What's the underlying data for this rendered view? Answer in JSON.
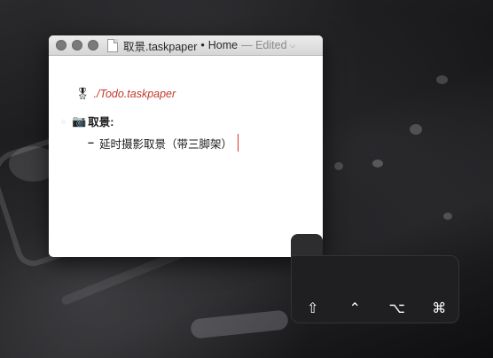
{
  "window": {
    "title_filename": "取景.taskpaper",
    "title_separator": "•",
    "title_location": "Home",
    "title_status": "— Edited"
  },
  "document": {
    "link_text": "./Todo.taskpaper",
    "project_title": "取景:",
    "task_text": "延时摄影取景（带三脚架）",
    "task_bullet": "–"
  },
  "icons": {
    "medal": "medal-icon",
    "camera": "camera-icon"
  },
  "hud": {
    "keys": [
      "⇧",
      "⌃",
      "⌥",
      "⌘"
    ]
  },
  "colors": {
    "link": "#c0392b",
    "caret": "#e03030"
  }
}
